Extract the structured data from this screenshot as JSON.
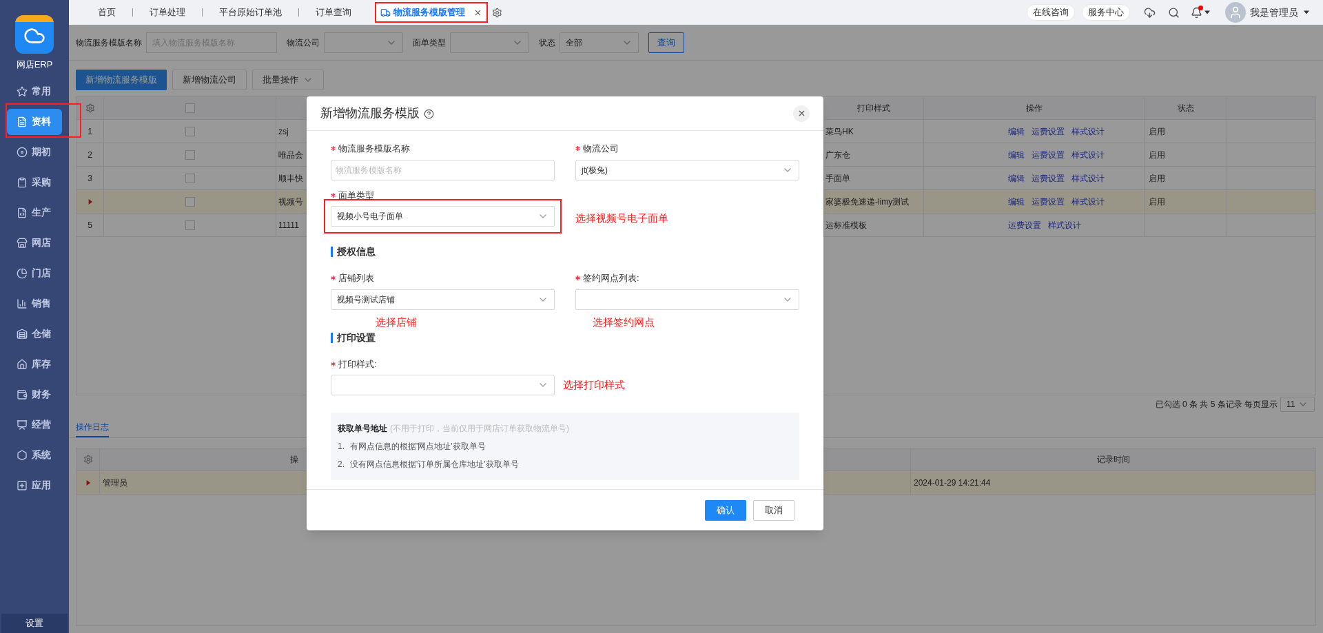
{
  "sidebar": {
    "app_name": "网店ERP",
    "items": [
      {
        "label": "常用",
        "selected": false
      },
      {
        "label": "资料",
        "selected": true
      },
      {
        "label": "期初",
        "selected": false
      },
      {
        "label": "采购",
        "selected": false
      },
      {
        "label": "生产",
        "selected": false
      },
      {
        "label": "网店",
        "selected": false
      },
      {
        "label": "门店",
        "selected": false
      },
      {
        "label": "销售",
        "selected": false
      },
      {
        "label": "仓储",
        "selected": false
      },
      {
        "label": "库存",
        "selected": false
      },
      {
        "label": "财务",
        "selected": false
      },
      {
        "label": "经营",
        "selected": false
      },
      {
        "label": "系统",
        "selected": false
      },
      {
        "label": "应用",
        "selected": false
      }
    ],
    "footer": "设置"
  },
  "tabs": [
    {
      "label": "首页",
      "selected": false
    },
    {
      "label": "订单处理",
      "selected": false
    },
    {
      "label": "平台原始订单池",
      "selected": false
    },
    {
      "label": "订单查询",
      "selected": false
    },
    {
      "label": "物流服务模版管理",
      "selected": true
    }
  ],
  "header": {
    "buttons": [
      "在线咨询",
      "服务中心"
    ],
    "has_unread": true,
    "user_name": "我是管理员"
  },
  "filters": [
    {
      "kind": "input",
      "label": "物流服务模版名称",
      "placeholder": "填入物流服务模版名称"
    },
    {
      "kind": "select",
      "label": "物流公司"
    },
    {
      "kind": "select",
      "label": "面单类型"
    },
    {
      "kind": "select",
      "label": "状态",
      "value": "全部"
    }
  ],
  "search_button": "查询",
  "toolbar": [
    {
      "kind": "primary",
      "label": "新增物流服务模版"
    },
    {
      "kind": "default",
      "label": "新增物流公司"
    },
    {
      "kind": "dropdown",
      "label": "批量操作"
    }
  ],
  "table": {
    "all_checked": false,
    "columns": [
      "打印样式",
      "操作",
      "状态"
    ],
    "rows": [
      {
        "index": "1",
        "selected": false,
        "checked": false,
        "name": "zsj",
        "print_style": "菜鸟HK",
        "actions": [
          "编辑",
          "运费设置",
          "样式设计"
        ],
        "status": "启用"
      },
      {
        "index": "2",
        "selected": false,
        "checked": false,
        "name": "唯品会",
        "print_style": "广东仓",
        "actions": [
          "编辑",
          "运费设置",
          "样式设计"
        ],
        "status": "启用"
      },
      {
        "index": "3",
        "selected": false,
        "checked": false,
        "name": "顺丰快",
        "print_style": "手面单",
        "actions": [
          "编辑",
          "运费设置",
          "样式设计"
        ],
        "status": "启用"
      },
      {
        "selected": true,
        "checked": false,
        "name": "视频号",
        "print_style": "家婆极免速递-limy测试",
        "actions": [
          "编辑",
          "运费设置",
          "样式设计"
        ],
        "status": "启用"
      },
      {
        "index": "5",
        "selected": false,
        "checked": false,
        "name": "11111",
        "print_style": "运标准模板",
        "actions": [
          "运费设置",
          "样式设计"
        ]
      }
    ]
  },
  "pagination": {
    "summary": "已勾选 0 条 共 5 条记录 每页显示",
    "page_size": "11"
  },
  "log": {
    "tabs": [
      {
        "label": "操作日志",
        "selected": true
      }
    ],
    "columns": [
      "操",
      "记录时间"
    ],
    "rows": [
      {
        "operator": "管理员",
        "time": "2024-01-29 14:21:44",
        "selected": true
      }
    ]
  },
  "modal": {
    "title": "新增物流服务模版",
    "basic_fields": [
      {
        "kind": "input",
        "label": "物流服务模版名称",
        "placeholder": "物流服务模版名称",
        "required": true
      },
      {
        "kind": "select",
        "label": "物流公司",
        "value": "jt(极兔)",
        "required": true
      }
    ],
    "card_type": {
      "label": "面单类型",
      "value": "视频小号电子面单",
      "required": true,
      "note": "选择视频号电子面单"
    },
    "auth_section": {
      "title": "授权信息",
      "fields": [
        {
          "label": "店铺列表",
          "value": "视频号测试店铺",
          "required": true,
          "note": "选择店铺"
        },
        {
          "label": "签约网点列表:",
          "required": true,
          "note": "选择签约网点"
        }
      ]
    },
    "print_section": {
      "title": "打印设置",
      "fields": [
        {
          "label": "打印样式:",
          "required": true,
          "note": "选择打印样式"
        }
      ]
    },
    "info": {
      "title": "获取单号地址",
      "subtitle": "(不用于打印，当前仅用于网店订单获取物流单号)",
      "items": [
        {
          "number": "1.",
          "text": "有网点信息的根据'网点地址'获取单号"
        },
        {
          "number": "2.",
          "text": "没有网点信息根据'订单所属仓库地址'获取单号"
        }
      ]
    },
    "buttons": [
      {
        "kind": "primary",
        "label": "确认"
      },
      {
        "kind": "default",
        "label": "取消"
      }
    ]
  }
}
